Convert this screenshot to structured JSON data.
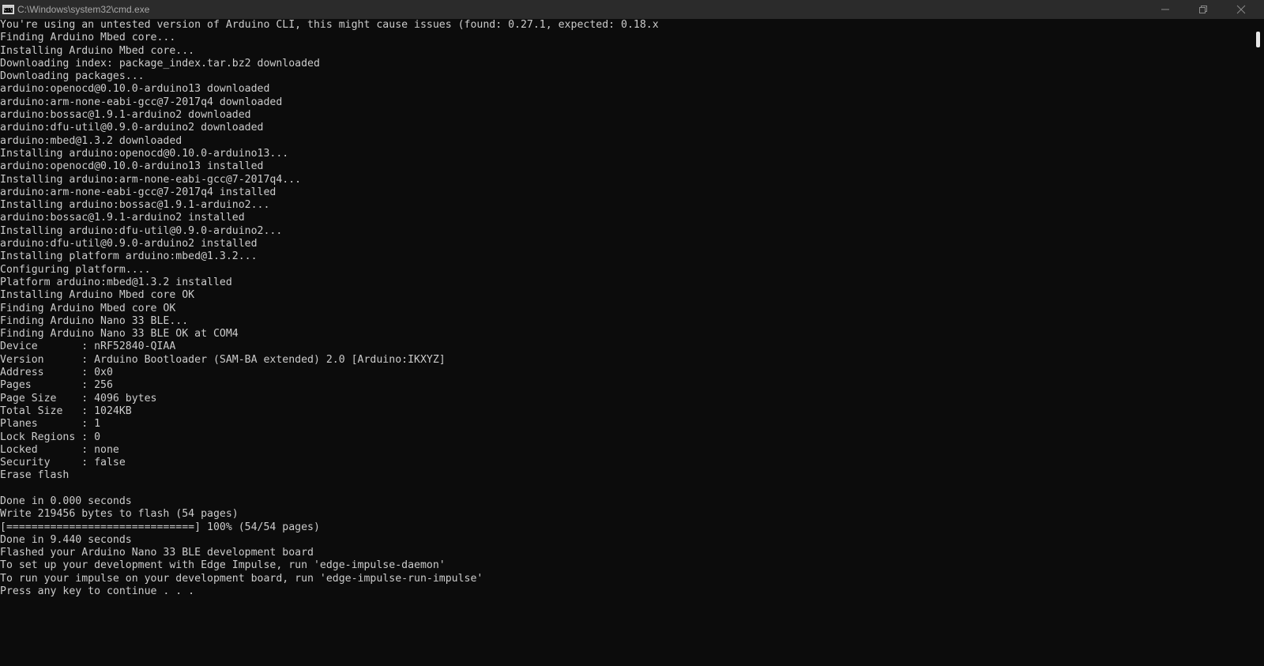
{
  "window": {
    "title": "C:\\Windows\\system32\\cmd.exe",
    "icon": "cmd-icon",
    "icon_text": "C:\\"
  },
  "controls": {
    "minimize": "minimize-icon",
    "maximize": "restore-icon",
    "close": "close-icon"
  },
  "colors": {
    "background": "#0c0c0c",
    "text": "#cccccc",
    "titlebar": "#2b2b2b"
  },
  "console": {
    "lines": [
      "You're using an untested version of Arduino CLI, this might cause issues (found: 0.27.1, expected: 0.18.x",
      "Finding Arduino Mbed core...",
      "Installing Arduino Mbed core...",
      "Downloading index: package_index.tar.bz2 downloaded",
      "Downloading packages...",
      "arduino:openocd@0.10.0-arduino13 downloaded",
      "arduino:arm-none-eabi-gcc@7-2017q4 downloaded",
      "arduino:bossac@1.9.1-arduino2 downloaded",
      "arduino:dfu-util@0.9.0-arduino2 downloaded",
      "arduino:mbed@1.3.2 downloaded",
      "Installing arduino:openocd@0.10.0-arduino13...",
      "arduino:openocd@0.10.0-arduino13 installed",
      "Installing arduino:arm-none-eabi-gcc@7-2017q4...",
      "arduino:arm-none-eabi-gcc@7-2017q4 installed",
      "Installing arduino:bossac@1.9.1-arduino2...",
      "arduino:bossac@1.9.1-arduino2 installed",
      "Installing arduino:dfu-util@0.9.0-arduino2...",
      "arduino:dfu-util@0.9.0-arduino2 installed",
      "Installing platform arduino:mbed@1.3.2...",
      "Configuring platform....",
      "Platform arduino:mbed@1.3.2 installed",
      "Installing Arduino Mbed core OK",
      "Finding Arduino Mbed core OK",
      "Finding Arduino Nano 33 BLE...",
      "Finding Arduino Nano 33 BLE OK at COM4",
      "Device       : nRF52840-QIAA",
      "Version      : Arduino Bootloader (SAM-BA extended) 2.0 [Arduino:IKXYZ]",
      "Address      : 0x0",
      "Pages        : 256",
      "Page Size    : 4096 bytes",
      "Total Size   : 1024KB",
      "Planes       : 1",
      "Lock Regions : 0",
      "Locked       : none",
      "Security     : false",
      "Erase flash",
      "",
      "Done in 0.000 seconds",
      "Write 219456 bytes to flash (54 pages)",
      "[==============================] 100% (54/54 pages)",
      "Done in 9.440 seconds",
      "Flashed your Arduino Nano 33 BLE development board",
      "To set up your development with Edge Impulse, run 'edge-impulse-daemon'",
      "To run your impulse on your development board, run 'edge-impulse-run-impulse'",
      "Press any key to continue . . ."
    ]
  }
}
